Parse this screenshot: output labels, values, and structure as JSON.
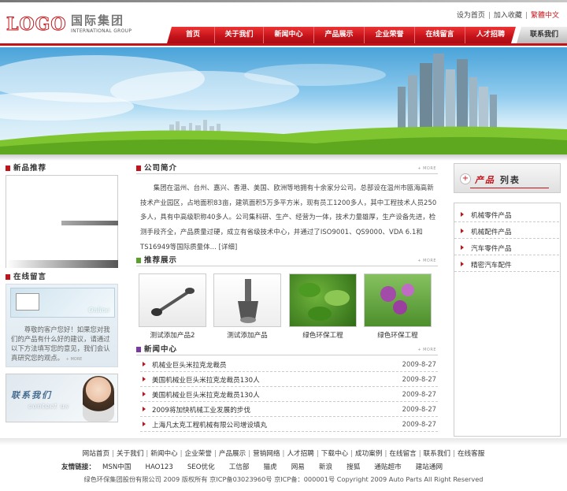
{
  "header": {
    "logo_text": "LOGO",
    "company_cn": "国际集团",
    "company_en": "INTERNATIONAL GROUP",
    "top_links": [
      "设为首页",
      "加入收藏",
      "繁體中文"
    ]
  },
  "nav": {
    "items": [
      "首页",
      "关于我们",
      "新闻中心",
      "产品展示",
      "企业荣誉",
      "在线留言",
      "人才招聘"
    ],
    "contact": "联系我们"
  },
  "colors": {
    "accent": "#c4121a",
    "green": "#5aa02c",
    "purple": "#7b3aa1"
  },
  "left": {
    "new_products_title": "新品推荐",
    "message_title": "在线留言",
    "message_online_label": "Online",
    "message_text": "尊敬的客户您好！如果您对我们的产品有什么好的建议，请通过以下方法填写您的意见，我们会认真研究您的观点。",
    "message_more": "+ MORE",
    "contact_title": "联系我们",
    "contact_sub": "contact us"
  },
  "about": {
    "title": "公司简介",
    "more": "+ MORE",
    "text": "集团在温州、台州、嘉兴、香港、美国、欧洲等地拥有十余家分公司。总部设在温州市瓯海高新技术产业园区，占地面积83亩，建筑面积5万多平方米，现有员工1200多人，其中工程技术人员250多人，具有中高级职称40多人。公司集科研、生产、经营为一体，技术力量雄厚，生产设备先进，检测手段齐全，产品质量过硬，成立有省级技术中心，并通过了ISO9001、QS9000、VDA 6.1和TS16949等国际质量体... [详细]"
  },
  "products": {
    "title": "推荐展示",
    "more": "+ MORE",
    "items": [
      {
        "caption": "测试添加产品2"
      },
      {
        "caption": "测试添加产品"
      },
      {
        "caption": "绿色环保工程"
      },
      {
        "caption": "绿色环保工程"
      }
    ]
  },
  "news": {
    "title": "新闻中心",
    "more": "+ MORE",
    "rows": [
      {
        "title": "机械业巨头米拉克龙裁员",
        "date": "2009-8-27"
      },
      {
        "title": "美国机械业巨头米拉克龙裁员130人",
        "date": "2009-8-27"
      },
      {
        "title": "美国机械业巨头米拉克龙裁员130人",
        "date": "2009-8-27"
      },
      {
        "title": "2009将加快机械工业发展的步伐",
        "date": "2009-8-27"
      },
      {
        "title": "上海凡太克工程机械有限公司增设填丸",
        "date": "2009-8-27"
      }
    ]
  },
  "right": {
    "title_red": "产品",
    "title_black": "列表",
    "circle": "+",
    "categories": [
      "机械零件产品",
      "机械配件产品",
      "汽车零件产品",
      "精密汽车配件"
    ]
  },
  "footer": {
    "links": [
      "网站首页",
      "关于我们",
      "新闻中心",
      "企业荣誉",
      "产品展示",
      "营销网络",
      "人才招聘",
      "下载中心",
      "成功案例",
      "在线留言",
      "联系我们",
      "在线客服"
    ],
    "friend_label": "友情链接：",
    "friend_links": [
      "MSN中国",
      "HAO123",
      "SEO优化",
      "工信部",
      "猫虎",
      "网易",
      "新浪",
      "搜狐",
      "通贴超市",
      "建站通网"
    ],
    "copyright": "绿色环保集团股份有限公司 2009 版权所有 京ICP备03023960号 京ICP备：000001号 Copyright 2009 Auto Parts All Right Reserved"
  }
}
